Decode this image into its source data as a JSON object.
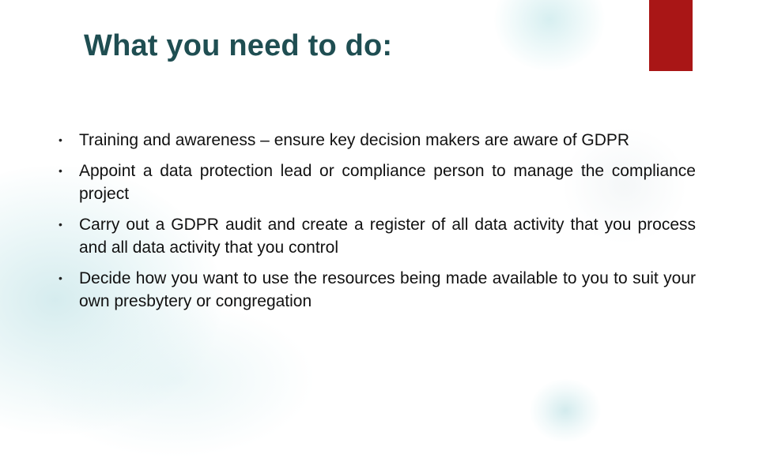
{
  "slide": {
    "title": "What you need to do:",
    "accent_color": "#a91616",
    "title_color": "#1f4e52",
    "bullet_icon": "bullet-dot",
    "bullet_glyph": "•",
    "bullets": [
      {
        "text": "Training and awareness – ensure key decision makers are aware of GDPR"
      },
      {
        "text": "Appoint a data protection lead or compliance person to manage the compliance project"
      },
      {
        "text": "Carry out a GDPR audit and create a register of all data activity that you process and all data activity that you control"
      },
      {
        "text": "Decide how you want to use the resources being made available to you to suit your own presbytery or congregation"
      }
    ]
  }
}
